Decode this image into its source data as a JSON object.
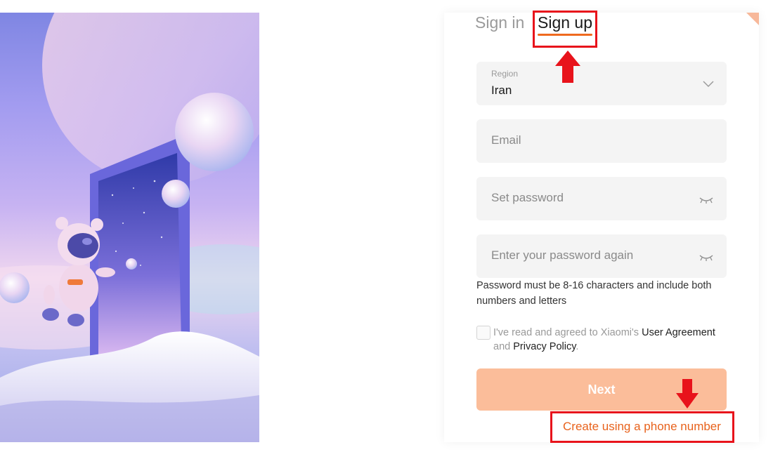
{
  "auth": {
    "tabs": [
      {
        "label": "Sign in",
        "active": false
      },
      {
        "label": "Sign up",
        "active": true
      }
    ]
  },
  "form": {
    "region": {
      "label": "Region",
      "value": "Iran"
    },
    "email": {
      "placeholder": "Email"
    },
    "password": {
      "placeholder": "Set password"
    },
    "confirm_password": {
      "placeholder": "Enter your password again"
    },
    "password_hint": "Password must be 8-16 characters and include both numbers and letters",
    "agreement": {
      "prefix": "I've read and agreed to Xiaomi's",
      "user_agreement": "User Agreement",
      "conjunction": "and",
      "privacy_policy": "Privacy Policy",
      "suffix": ".",
      "checked": false
    },
    "next_button": "Next",
    "alt_signup_link": "Create using a phone number"
  },
  "colors": {
    "accent": "#ef6a1f",
    "button_disabled": "#fbbd9a",
    "annotation": "#e8131b"
  },
  "icons": {
    "region_dropdown": "chevron-down-icon",
    "password_visibility": "eye-closed-icon",
    "confirm_visibility": "eye-closed-icon"
  }
}
